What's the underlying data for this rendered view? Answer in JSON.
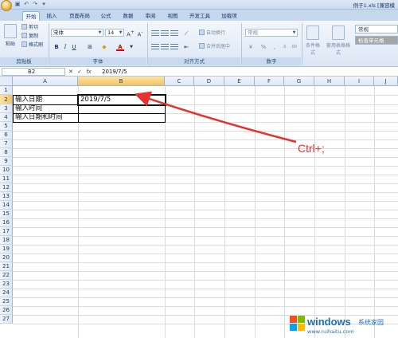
{
  "window": {
    "title": "例子1.xls [兼容模"
  },
  "tabs": [
    "开始",
    "插入",
    "页面布局",
    "公式",
    "数据",
    "审阅",
    "视图",
    "开发工具",
    "加载项"
  ],
  "ribbon": {
    "clipboard": {
      "paste": "粘贴",
      "cut": "剪切",
      "copy": "复制",
      "format_painter": "格式刷",
      "label": "剪贴板"
    },
    "font": {
      "name": "宋体",
      "size": "14",
      "label": "字体"
    },
    "alignment": {
      "wrap": "自动换行",
      "merge": "合并后居中",
      "label": "对齐方式"
    },
    "number": {
      "format": "常规",
      "label": "数字"
    },
    "styles": {
      "conditional": "条件格式",
      "table": "套用表格格式",
      "style_normal": "常规",
      "style_check": "检查单元格"
    }
  },
  "formula_bar": {
    "name_box": "B2",
    "fx": "fx",
    "content": "2019/7/5"
  },
  "columns": [
    "A",
    "B",
    "C",
    "D",
    "E",
    "F",
    "G",
    "H",
    "I",
    "J"
  ],
  "rows": [
    "1",
    "2",
    "3",
    "4",
    "5",
    "6",
    "7",
    "8",
    "9",
    "10",
    "11",
    "12",
    "13",
    "14",
    "15",
    "16",
    "17",
    "18",
    "19",
    "20",
    "21",
    "22",
    "23",
    "24",
    "25",
    "26",
    "27"
  ],
  "cells": {
    "a2": "输入日期",
    "a3": "输入时间",
    "a4": "输入日期和时间",
    "b2": "2019/7/5"
  },
  "annotation": "Ctrl+;",
  "colors": {
    "arrow": "#e8302c",
    "selected_header": "#f6c35b"
  },
  "watermark": {
    "brand": "windows",
    "sub": "系统家园",
    "url": "www.ruihaitu.com"
  }
}
